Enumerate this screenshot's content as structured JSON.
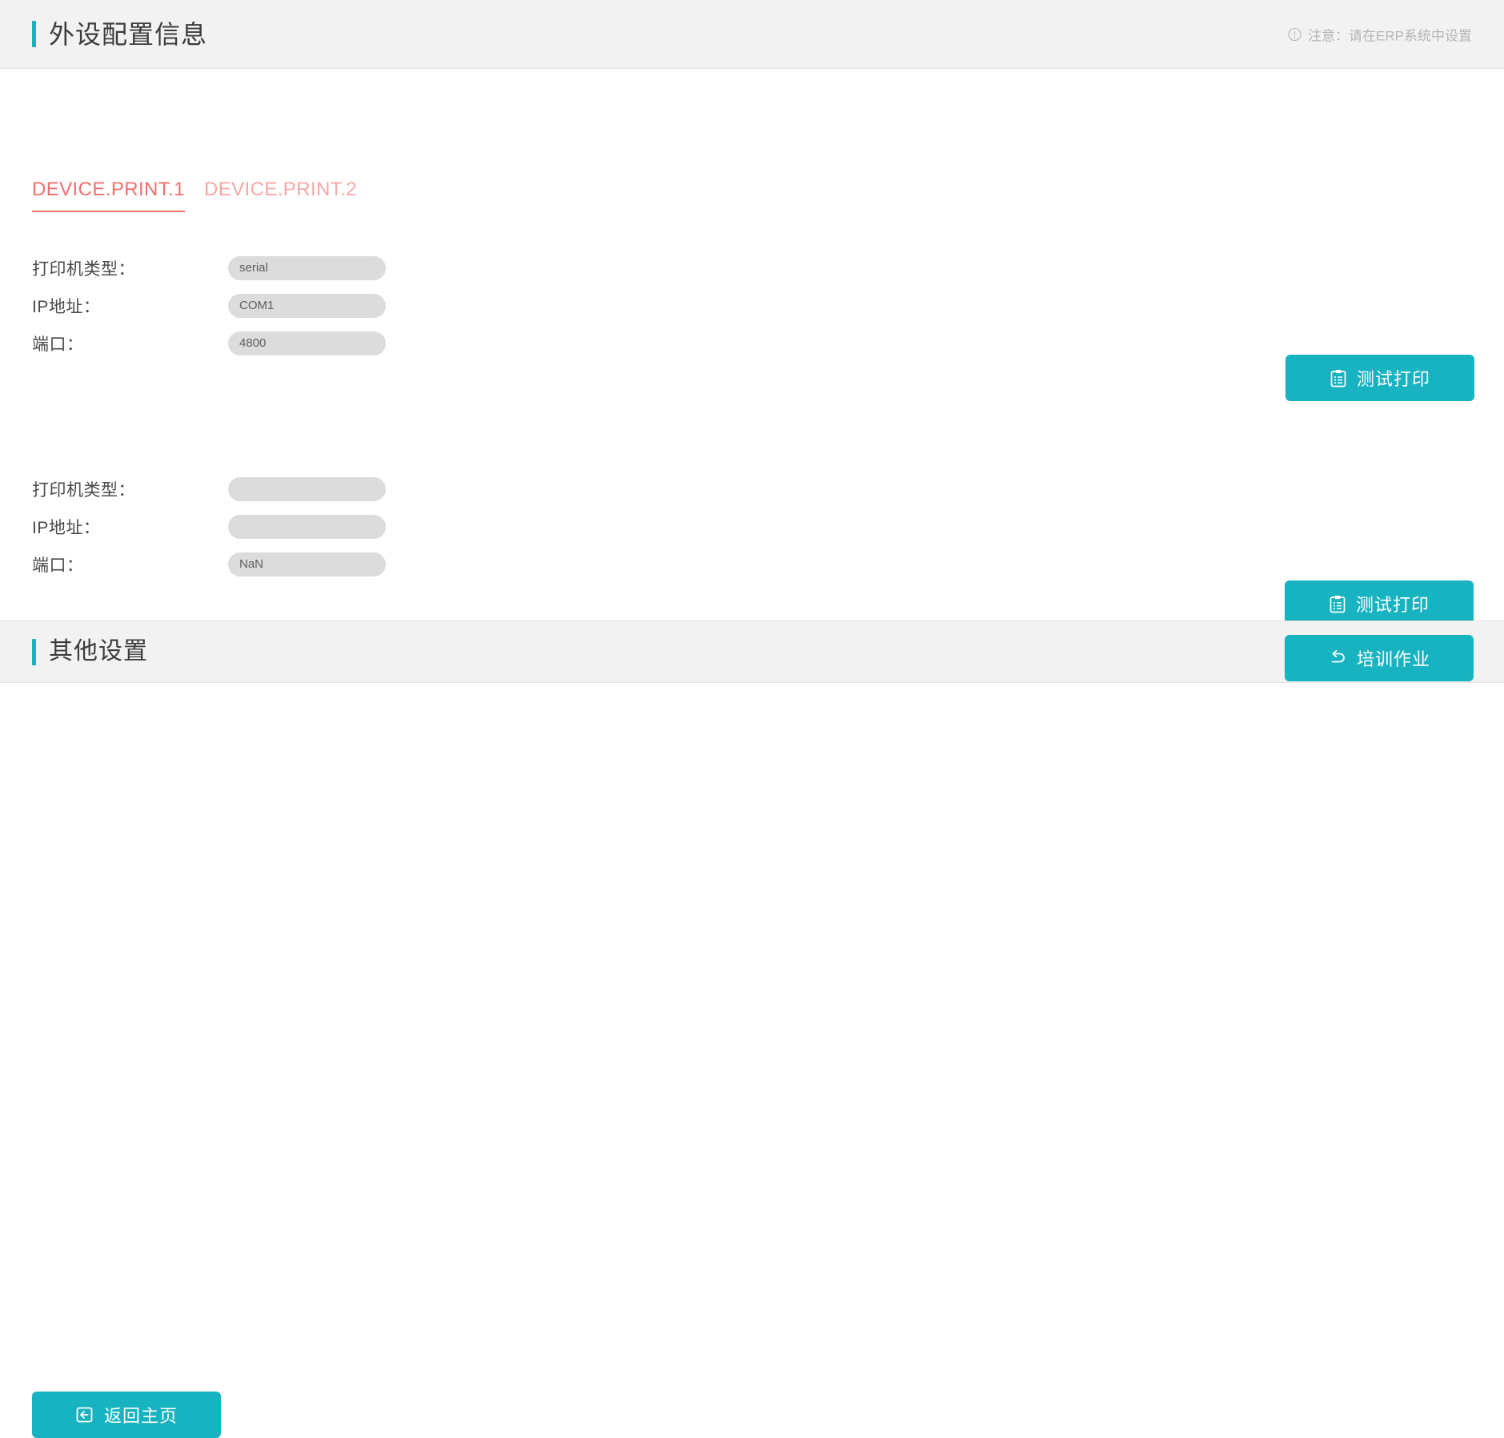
{
  "header": {
    "title": "外设配置信息",
    "notice_icon": "exclamation-circle-icon",
    "notice_text": "注意：请在ERP系统中设置",
    "accent_color": "#16b2bf"
  },
  "tabs": [
    {
      "label": "DEVICE.PRINT.1",
      "active": true
    },
    {
      "label": "DEVICE.PRINT.2",
      "active": false
    }
  ],
  "tab_colors": {
    "active": "#f0706e",
    "inactive": "#f6a7a7"
  },
  "printer_groups": [
    {
      "rows": [
        {
          "label": "打印机类型：",
          "value": "serial"
        },
        {
          "label": "IP地址：",
          "value": "COM1"
        },
        {
          "label": "端口：",
          "value": "4800"
        }
      ],
      "test_button": {
        "label": "测试打印",
        "icon": "clipboard-list-icon"
      }
    },
    {
      "rows": [
        {
          "label": "打印机类型：",
          "value": ""
        },
        {
          "label": "IP地址：",
          "value": ""
        },
        {
          "label": "端口：",
          "value": "NaN"
        }
      ],
      "test_button": {
        "label": "测试打印",
        "icon": "clipboard-list-icon"
      }
    }
  ],
  "other_settings": {
    "title": "其他设置",
    "training_button": {
      "label": "培训作业",
      "icon": "undo-arrow-icon"
    }
  },
  "footer": {
    "home_button": {
      "label": "返回主页",
      "icon": "logout-box-left-icon"
    }
  },
  "colors": {
    "teal": "#17b3c0",
    "field_bg": "#dcdcdc",
    "header_bg": "#f2f2f2"
  }
}
